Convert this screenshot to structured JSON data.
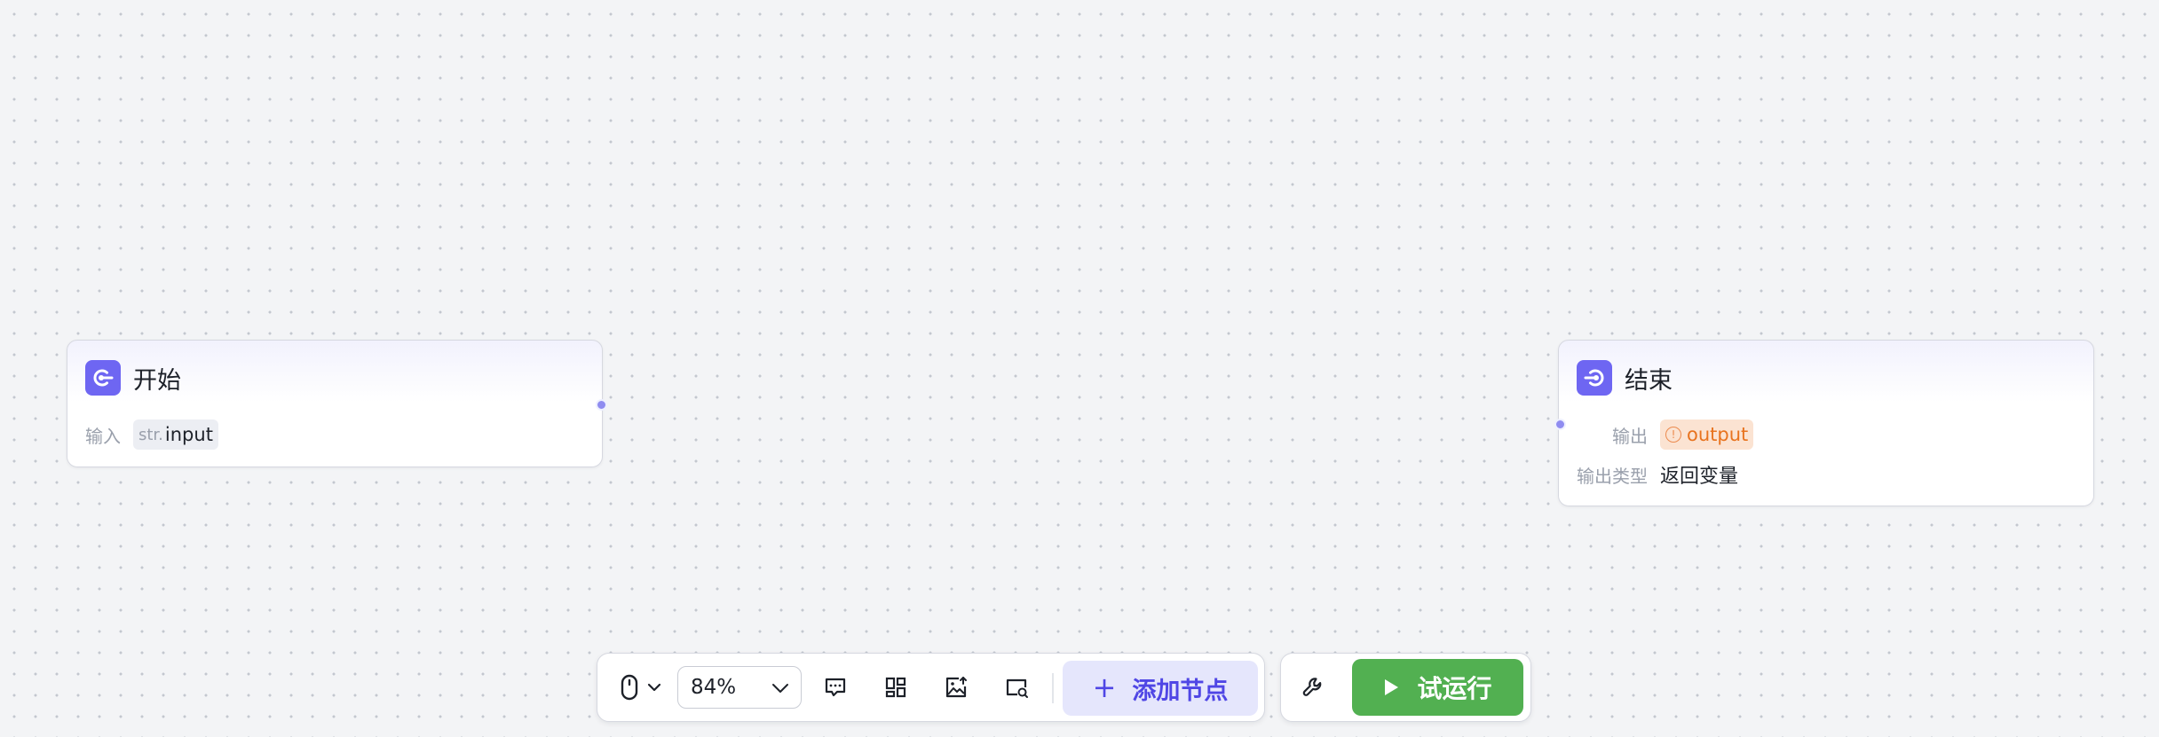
{
  "nodes": {
    "start": {
      "title": "开始",
      "input_label": "输入",
      "input_type": "str.",
      "input_name": "input"
    },
    "end": {
      "title": "结束",
      "output_label": "输出",
      "output_name": "output",
      "output_type_label": "输出类型",
      "output_type_value": "返回变量"
    }
  },
  "toolbar": {
    "zoom_level": "84%",
    "add_node_label": "添加节点",
    "run_label": "试运行"
  },
  "colors": {
    "canvas": "#f3f4f6",
    "accent": "#6e66f2",
    "add_node_bg": "#e5e6fc",
    "add_node_text": "#4f46e5",
    "run_bg": "#52b051",
    "warning": "#e8731e"
  },
  "icons": {
    "start": "start-node-icon",
    "end": "end-node-icon",
    "interaction_mode": "mouse-icon",
    "comment": "comment-icon",
    "layout": "grid-layout-icon",
    "export_image": "image-export-icon",
    "minimap": "minimap-icon",
    "settings": "wrench-icon",
    "run": "play-icon"
  }
}
